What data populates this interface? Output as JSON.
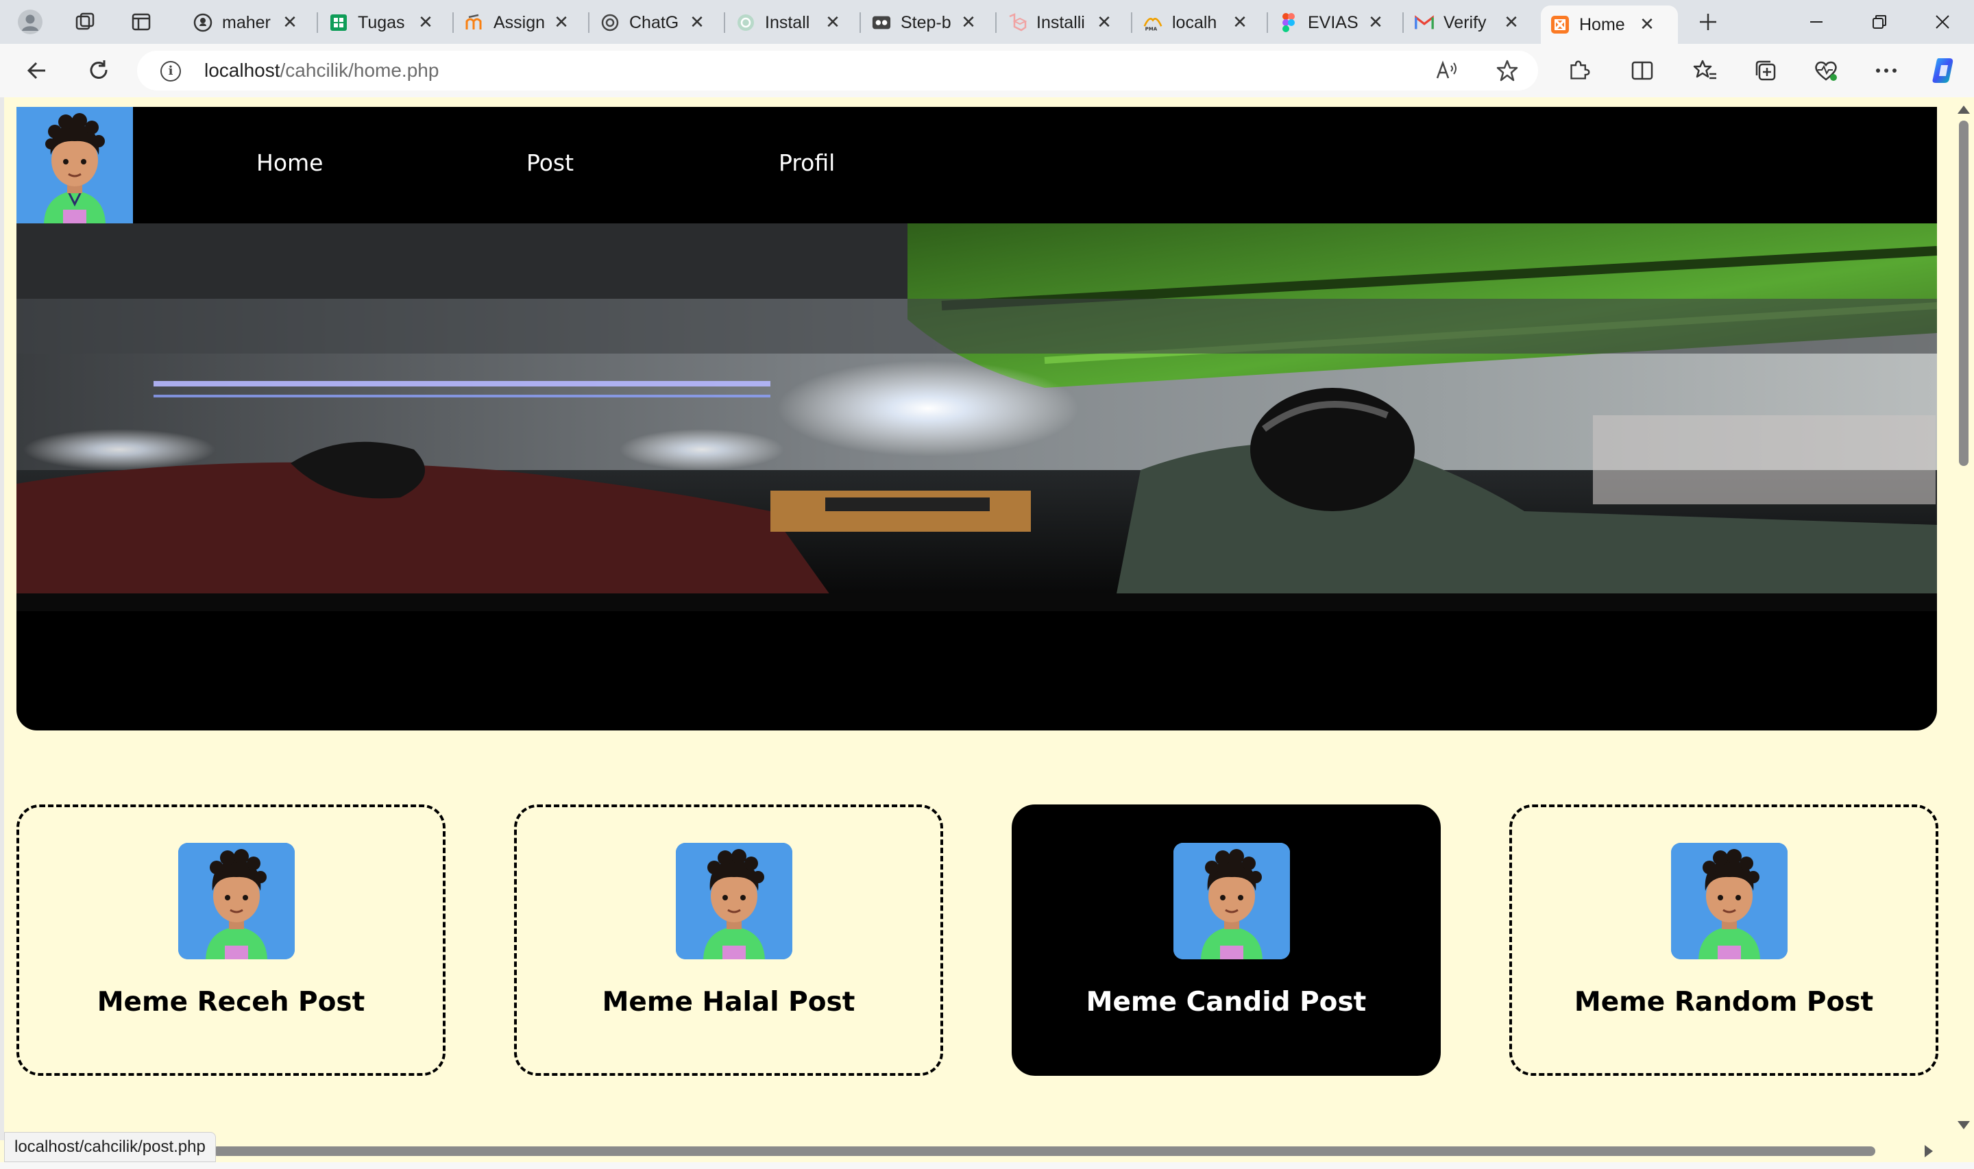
{
  "browser": {
    "tabs": [
      {
        "title": "maher",
        "icon": "github-icon"
      },
      {
        "title": "Tugas",
        "icon": "sheets-icon"
      },
      {
        "title": "Assign",
        "icon": "moodle-icon"
      },
      {
        "title": "ChatG",
        "icon": "chatgpt-icon"
      },
      {
        "title": "Install",
        "icon": "openai-icon"
      },
      {
        "title": "Step-b",
        "icon": "video-icon"
      },
      {
        "title": "Installi",
        "icon": "laravel-icon"
      },
      {
        "title": "localh",
        "icon": "phpmyadmin-icon"
      },
      {
        "title": "EVIASI",
        "icon": "figma-icon"
      },
      {
        "title": "Verify",
        "icon": "gmail-icon"
      },
      {
        "title": "Home",
        "icon": "xampp-icon",
        "active": true
      }
    ],
    "address": {
      "host": "localhost",
      "path": "/cahcilik/home.php"
    },
    "status_url": "localhost/cahcilik/post.php"
  },
  "navbar": {
    "links": [
      {
        "label": "Home"
      },
      {
        "label": "Post"
      },
      {
        "label": "Profil"
      }
    ]
  },
  "cards": [
    {
      "title": "Meme Receh Post",
      "style": "dashed"
    },
    {
      "title": "Meme Halal Post",
      "style": "dashed"
    },
    {
      "title": "Meme Candid Post",
      "style": "dark"
    },
    {
      "title": "Meme Random Post",
      "style": "dashed"
    }
  ],
  "colors": {
    "page_bg": "#fffbd9",
    "nav_bg": "#000000",
    "avatar_bg": "#4d9be8",
    "card_dark": "#000000"
  }
}
